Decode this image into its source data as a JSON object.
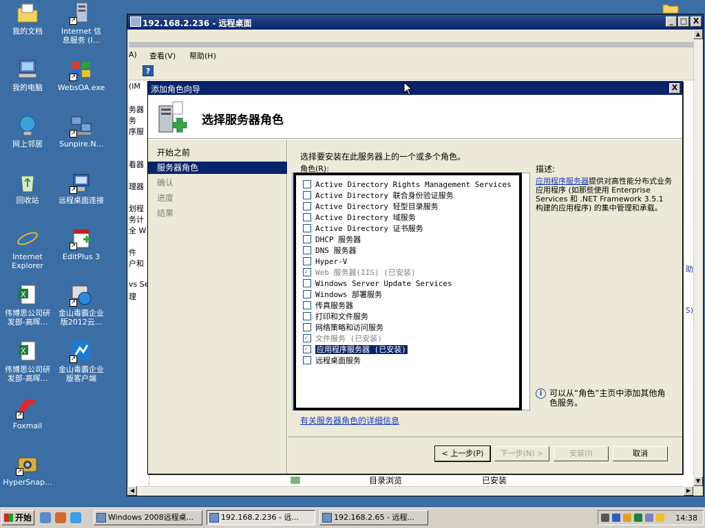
{
  "desktop": {
    "icons": [
      {
        "label": "我的文档"
      },
      {
        "label": "Internet 信\n息服务 (I..."
      },
      {
        "label": "我的电脑"
      },
      {
        "label": "WebsOA.exe"
      },
      {
        "label": "网上邻居"
      },
      {
        "label": "Sunpire.N..."
      },
      {
        "label": "回收站"
      },
      {
        "label": "远程桌面连接"
      },
      {
        "label": "Internet\nExplorer"
      },
      {
        "label": "EditPlus 3"
      },
      {
        "label": "伟博思公司研\n发部-高晖..."
      },
      {
        "label": "金山毒霸企业\n版2012云..."
      },
      {
        "label": "伟博思公司研\n发部-高晖..."
      },
      {
        "label": "金山毒霸企业\n版客户端"
      },
      {
        "label": "Foxmail"
      },
      {
        "label": "HyperSnap..."
      }
    ]
  },
  "rdwindow": {
    "title": "192.168.2.236 - 远程桌面",
    "min": "_",
    "max": "□",
    "close": "X"
  },
  "servermanager": {
    "menu": [
      "A)",
      "查看(V)",
      "帮助(H)"
    ],
    "help_icon": "?",
    "left_fragments": [
      "(IM",
      "务器",
      "务",
      "序服",
      "看器",
      "理器",
      "划程",
      "务计",
      "全 W",
      "件",
      "户和",
      "vs Se",
      "理"
    ],
    "right_fragments": [
      "助",
      "S)"
    ]
  },
  "wizard": {
    "title": "添加角色向导",
    "close": "X",
    "header_title": "选择服务器角色",
    "nav": [
      {
        "label": "开始之前",
        "state": "normal"
      },
      {
        "label": "服务器角色",
        "state": "active"
      },
      {
        "label": "确认",
        "state": "dim"
      },
      {
        "label": "进度",
        "state": "dim"
      },
      {
        "label": "结果",
        "state": "dim"
      }
    ],
    "instruction": "选择要安装在此服务器上的一个或多个角色。",
    "roles_label": "角色(R):",
    "roles": [
      {
        "label": "Active Directory Rights Management Services",
        "checked": false,
        "installed": false,
        "selected": false
      },
      {
        "label": "Active Directory 联合身份验证服务",
        "checked": false,
        "installed": false,
        "selected": false
      },
      {
        "label": "Active Directory 轻型目录服务",
        "checked": false,
        "installed": false,
        "selected": false
      },
      {
        "label": "Active Directory 域服务",
        "checked": false,
        "installed": false,
        "selected": false
      },
      {
        "label": "Active Directory 证书服务",
        "checked": false,
        "installed": false,
        "selected": false
      },
      {
        "label": "DHCP 服务器",
        "checked": false,
        "installed": false,
        "selected": false
      },
      {
        "label": "DNS 服务器",
        "checked": false,
        "installed": false,
        "selected": false
      },
      {
        "label": "Hyper-V",
        "checked": false,
        "installed": false,
        "selected": false
      },
      {
        "label": "Web 服务器(IIS)  (已安装)",
        "checked": true,
        "installed": true,
        "selected": false
      },
      {
        "label": "Windows Server Update Services",
        "checked": false,
        "installed": false,
        "selected": false
      },
      {
        "label": "Windows 部署服务",
        "checked": false,
        "installed": false,
        "selected": false
      },
      {
        "label": "传真服务器",
        "checked": false,
        "installed": false,
        "selected": false
      },
      {
        "label": "打印和文件服务",
        "checked": false,
        "installed": false,
        "selected": false
      },
      {
        "label": "网络策略和访问服务",
        "checked": false,
        "installed": false,
        "selected": false
      },
      {
        "label": "文件服务  (已安装)",
        "checked": true,
        "installed": true,
        "selected": false
      },
      {
        "label": "应用程序服务器  (已安装)",
        "checked": true,
        "installed": false,
        "selected": true
      },
      {
        "label": "远程桌面服务",
        "checked": false,
        "installed": false,
        "selected": false
      }
    ],
    "description_label": "描述:",
    "description_link": "应用程序服务器",
    "description_text": "提供对高性能分布式业务应用程序 (如那些使用 Enterprise Services 和 .NET Framework 3.5.1 构建的应用程序) 的集中管理和承载。",
    "note": "可以从“角色”主页中添加其他角色服务。",
    "more_info_link": "有关服务器角色的详细信息",
    "buttons": {
      "back": "< 上一步(P)",
      "next": "下一步(N) >",
      "install": "安装(I)",
      "cancel": "取消"
    }
  },
  "background_list": {
    "name": "目录浏览",
    "status": "已安装"
  },
  "taskbar": {
    "start": "开始",
    "tasks": [
      {
        "label": "Windows 2008远程桌..."
      },
      {
        "label": "192.168.2.236 - 远..."
      },
      {
        "label": "192.168.2.65 - 远程..."
      }
    ],
    "clock": "14:38"
  }
}
